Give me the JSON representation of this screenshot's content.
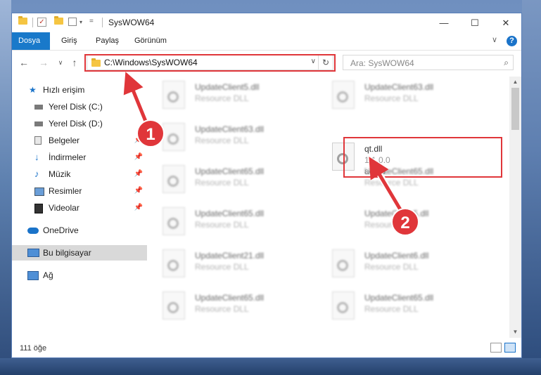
{
  "window": {
    "title": "SysWOW64",
    "minimize": "—",
    "maximize": "☐",
    "close": "✕"
  },
  "ribbon": {
    "tabs": [
      "Dosya",
      "Giriş",
      "Paylaş",
      "Görünüm"
    ],
    "collapse": "∨",
    "help": "?"
  },
  "address": {
    "path": "C:\\Windows\\SysWOW64",
    "dropdown": "∨",
    "refresh": "↻"
  },
  "search": {
    "placeholder": "Ara: SysWOW64",
    "icon": "⌕"
  },
  "nav": {
    "back": "←",
    "forward": "→",
    "recent": "∨",
    "up": "↑"
  },
  "sidebar": {
    "items": [
      {
        "label": "Hızlı erişim",
        "icon": "star-icon"
      },
      {
        "label": "Yerel Disk (C:)",
        "icon": "drive-icon"
      },
      {
        "label": "Yerel Disk (D:)",
        "icon": "drive-icon"
      },
      {
        "label": "Belgeler",
        "icon": "documents-icon"
      },
      {
        "label": "İndirmeler",
        "icon": "download-icon"
      },
      {
        "label": "Müzik",
        "icon": "music-icon"
      },
      {
        "label": "Resimler",
        "icon": "pictures-icon"
      },
      {
        "label": "Videolar",
        "icon": "videos-icon"
      },
      {
        "label": "OneDrive",
        "icon": "cloud-icon"
      },
      {
        "label": "Bu bilgisayar",
        "icon": "computer-icon"
      },
      {
        "label": "Ağ",
        "icon": "network-icon"
      }
    ],
    "pin": "📌"
  },
  "files": {
    "left": [
      {
        "name": "UpdateClient5.dll",
        "type": "Resource DLL"
      },
      {
        "name": "UpdateClient63.dll",
        "type": "Resource DLL"
      },
      {
        "name": "UpdateClient65.dll",
        "type": "Resource DLL"
      },
      {
        "name": "UpdateClient65.dll",
        "type": "Resource DLL"
      },
      {
        "name": "UpdateClient21.dll",
        "type": "Resource DLL"
      },
      {
        "name": "UpdateClient65.dll",
        "type": "Resource DLL"
      }
    ],
    "right": [
      {
        "name": "UpdateClient63.dll",
        "type": "Resource DLL"
      },
      {
        "name": "UpdateClient65.dll",
        "type": "Resource DLL"
      },
      {
        "name": "UpdateClient5.dll",
        "type": "Resource DLL"
      },
      {
        "name": "UpdateClient6.dll",
        "type": "Resource DLL"
      },
      {
        "name": "UpdateClient65.dll",
        "type": "Resource DLL"
      }
    ],
    "highlighted": {
      "name": "qt.dll",
      "version": "1.1.0.0",
      "description": "aeqt3"
    }
  },
  "status": {
    "count": "111 öğe"
  },
  "scroll": {
    "up": "▲",
    "down": "▼"
  },
  "annotations": {
    "step1": "1",
    "step2": "2"
  }
}
